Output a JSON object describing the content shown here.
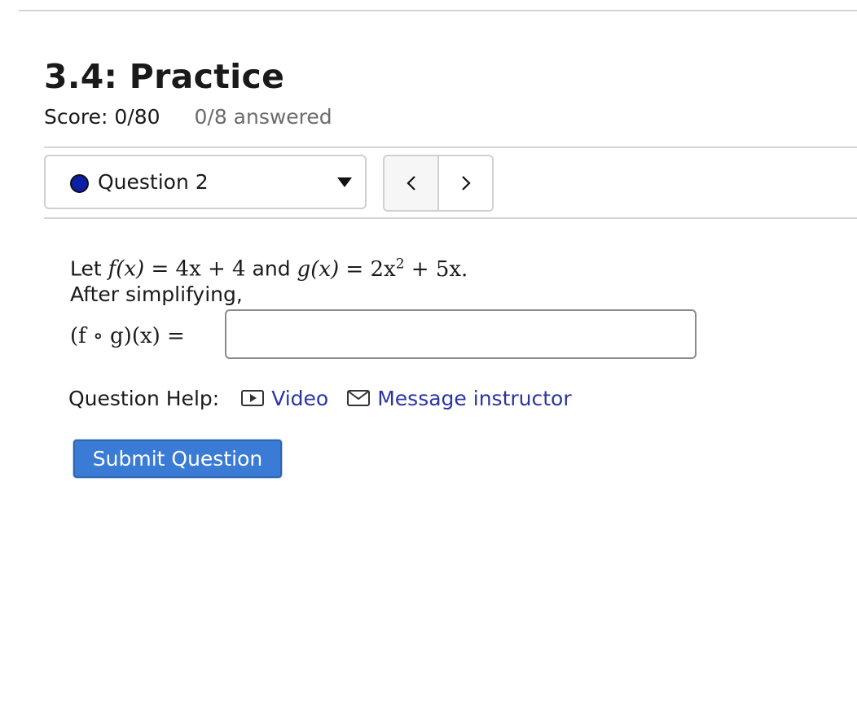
{
  "page": {
    "title": "3.4: Practice",
    "score": "Score: 0/80",
    "answered": "0/8 answered"
  },
  "question_nav": {
    "selected_question": "Question 2",
    "status_color": "#0d1fa6",
    "prev_icon": "chevron-left-icon",
    "next_icon": "chevron-right-icon"
  },
  "problem": {
    "lead_word": "Let",
    "f_lhs": "f(x)",
    "f_rhs": "4x + 4",
    "joiner": "and",
    "g_lhs": "g(x)",
    "g_rhs_base": "2x",
    "g_rhs_exp": "2",
    "g_rhs_tail": "+ 5x.",
    "instruction": "After simplifying,",
    "composition_lhs": "(f ∘ g)(x)",
    "equals": "=",
    "answer_value": "",
    "answer_placeholder": ""
  },
  "help": {
    "label": "Question Help:",
    "video_label": "Video",
    "video_icon": "video-play-icon",
    "message_label": "Message instructor",
    "message_icon": "envelope-icon",
    "link_color": "#2b35a3"
  },
  "actions": {
    "submit_label": "Submit Question",
    "submit_color": "#3a7bd5"
  }
}
